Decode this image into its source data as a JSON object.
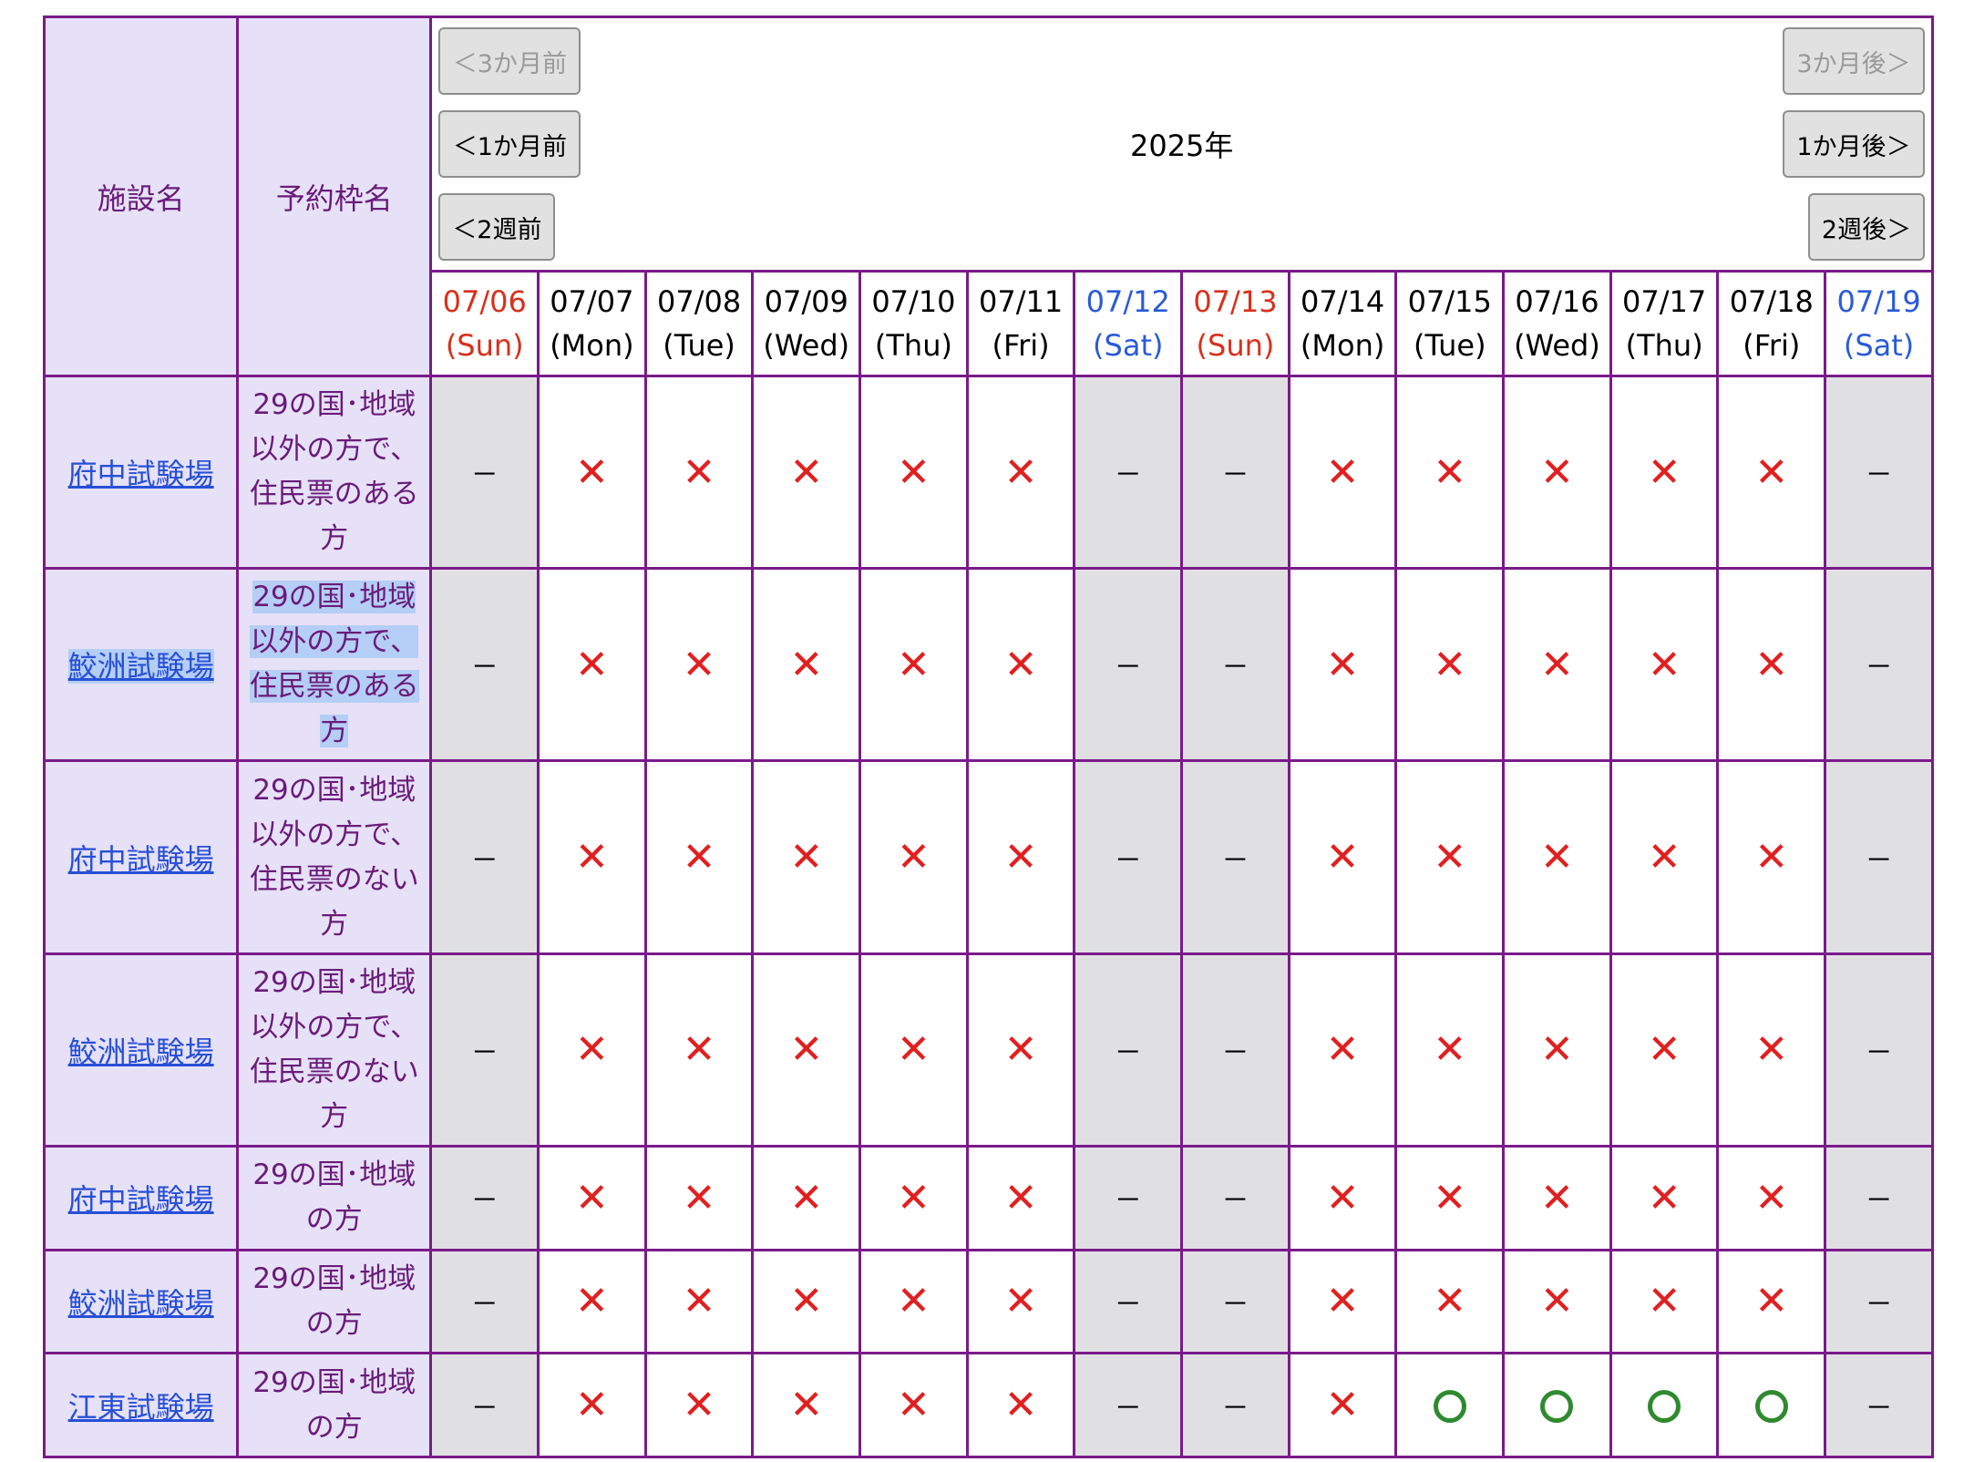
{
  "header": {
    "facility_label": "施設名",
    "plan_label": "予約枠名",
    "year": "2025年"
  },
  "nav": {
    "prev_3m": "＜3か月前",
    "prev_1m": "＜1か月前",
    "prev_2w": "＜2週前",
    "next_3m": "3か月後＞",
    "next_1m": "1か月後＞",
    "next_2w": "2週後＞"
  },
  "dates": [
    {
      "date": "07/06",
      "dow": "(Sun)",
      "type": "sun"
    },
    {
      "date": "07/07",
      "dow": "(Mon)",
      "type": "weekday"
    },
    {
      "date": "07/08",
      "dow": "(Tue)",
      "type": "weekday"
    },
    {
      "date": "07/09",
      "dow": "(Wed)",
      "type": "weekday"
    },
    {
      "date": "07/10",
      "dow": "(Thu)",
      "type": "weekday"
    },
    {
      "date": "07/11",
      "dow": "(Fri)",
      "type": "weekday"
    },
    {
      "date": "07/12",
      "dow": "(Sat)",
      "type": "sat"
    },
    {
      "date": "07/13",
      "dow": "(Sun)",
      "type": "sun"
    },
    {
      "date": "07/14",
      "dow": "(Mon)",
      "type": "weekday"
    },
    {
      "date": "07/15",
      "dow": "(Tue)",
      "type": "weekday"
    },
    {
      "date": "07/16",
      "dow": "(Wed)",
      "type": "weekday"
    },
    {
      "date": "07/17",
      "dow": "(Thu)",
      "type": "weekday"
    },
    {
      "date": "07/18",
      "dow": "(Fri)",
      "type": "weekday"
    },
    {
      "date": "07/19",
      "dow": "(Sat)",
      "type": "sat"
    }
  ],
  "symbols": {
    "x": "✕",
    "dash": "－"
  },
  "rows": [
    {
      "facility": "府中試験場",
      "plan": [
        "29の国･地域",
        "以外の方で、",
        "住民票のある",
        "方"
      ],
      "selected": false,
      "status": [
        "dash",
        "x",
        "x",
        "x",
        "x",
        "x",
        "dash",
        "dash",
        "x",
        "x",
        "x",
        "x",
        "x",
        "dash"
      ]
    },
    {
      "facility": "鮫洲試験場",
      "plan": [
        "29の国･地域",
        "以外の方で、",
        "住民票のある",
        "方"
      ],
      "selected": true,
      "status": [
        "dash",
        "x",
        "x",
        "x",
        "x",
        "x",
        "dash",
        "dash",
        "x",
        "x",
        "x",
        "x",
        "x",
        "dash"
      ]
    },
    {
      "facility": "府中試験場",
      "plan": [
        "29の国･地域",
        "以外の方で、",
        "住民票のない",
        "方"
      ],
      "selected": false,
      "status": [
        "dash",
        "x",
        "x",
        "x",
        "x",
        "x",
        "dash",
        "dash",
        "x",
        "x",
        "x",
        "x",
        "x",
        "dash"
      ]
    },
    {
      "facility": "鮫洲試験場",
      "plan": [
        "29の国･地域",
        "以外の方で、",
        "住民票のない",
        "方"
      ],
      "selected": false,
      "status": [
        "dash",
        "x",
        "x",
        "x",
        "x",
        "x",
        "dash",
        "dash",
        "x",
        "x",
        "x",
        "x",
        "x",
        "dash"
      ]
    },
    {
      "facility": "府中試験場",
      "plan": [
        "29の国･地域",
        "の方"
      ],
      "selected": false,
      "status": [
        "dash",
        "x",
        "x",
        "x",
        "x",
        "x",
        "dash",
        "dash",
        "x",
        "x",
        "x",
        "x",
        "x",
        "dash"
      ]
    },
    {
      "facility": "鮫洲試験場",
      "plan": [
        "29の国･地域",
        "の方"
      ],
      "selected": false,
      "status": [
        "dash",
        "x",
        "x",
        "x",
        "x",
        "x",
        "dash",
        "dash",
        "x",
        "x",
        "x",
        "x",
        "x",
        "dash"
      ]
    },
    {
      "facility": "江東試験場",
      "plan": [
        "29の国･地域",
        "の方"
      ],
      "selected": false,
      "status": [
        "dash",
        "x",
        "x",
        "x",
        "x",
        "x",
        "dash",
        "dash",
        "x",
        "o",
        "o",
        "o",
        "o",
        "dash"
      ]
    }
  ]
}
